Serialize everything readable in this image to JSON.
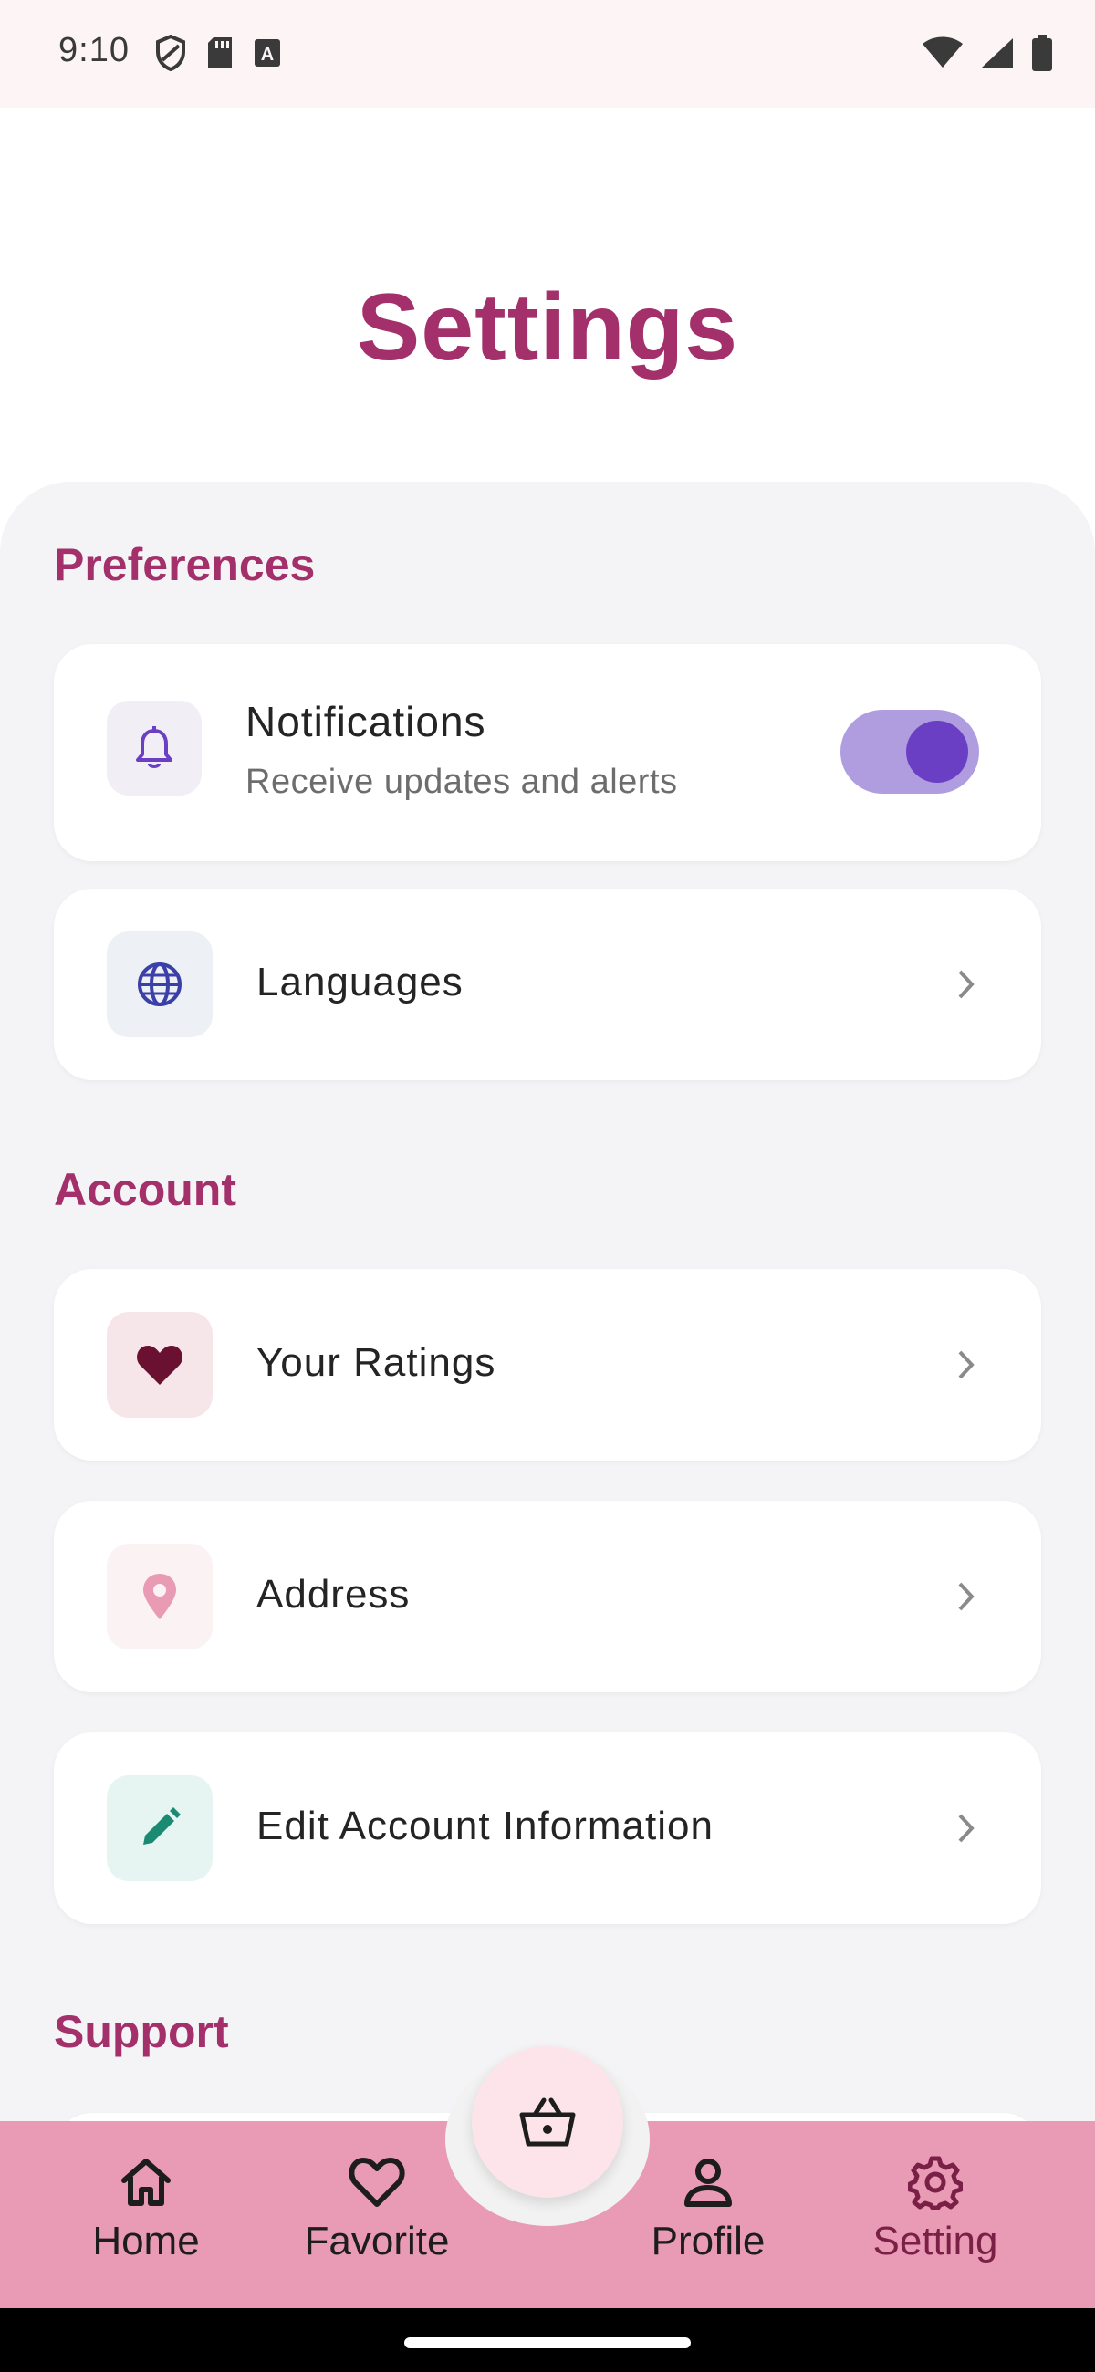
{
  "status_bar": {
    "time": "9:10"
  },
  "page": {
    "title": "Settings"
  },
  "sections": {
    "preferences": "Preferences",
    "account": "Account",
    "support": "Support"
  },
  "notifications": {
    "title": "Notifications",
    "subtitle": "Receive updates and alerts",
    "enabled": true,
    "icon": "bell-icon",
    "icon_bg": "#f1eef6",
    "icon_color": "#6a3fc4"
  },
  "languages": {
    "label": "Languages",
    "icon": "globe-icon",
    "icon_bg": "#edf0f5",
    "icon_color": "#3b3fa8"
  },
  "account_items": [
    {
      "label": "Your Ratings",
      "icon": "heart-icon",
      "icon_bg": "#f6e6ea",
      "icon_color": "#6a1030"
    },
    {
      "label": "Address",
      "icon": "location-pin-icon",
      "icon_bg": "#fbf2f4",
      "icon_color": "#e99ab4"
    },
    {
      "label": "Edit Account Information",
      "icon": "pencil-icon",
      "icon_bg": "#e6f5f2",
      "icon_color": "#1b8a72"
    }
  ],
  "bottom_nav": {
    "fab_icon": "basket-icon",
    "items": [
      {
        "label": "Home",
        "icon": "home-icon",
        "active": false
      },
      {
        "label": "Favorite",
        "icon": "heart-outline-icon",
        "active": false
      },
      {
        "label": "Profile",
        "icon": "person-icon",
        "active": false
      },
      {
        "label": "Setting",
        "icon": "gear-icon",
        "active": true
      }
    ]
  },
  "colors": {
    "accent": "#a3306a",
    "nav_background": "#e99ab4",
    "toggle_track": "#b09ddf",
    "toggle_knob": "#6a3fc4"
  }
}
